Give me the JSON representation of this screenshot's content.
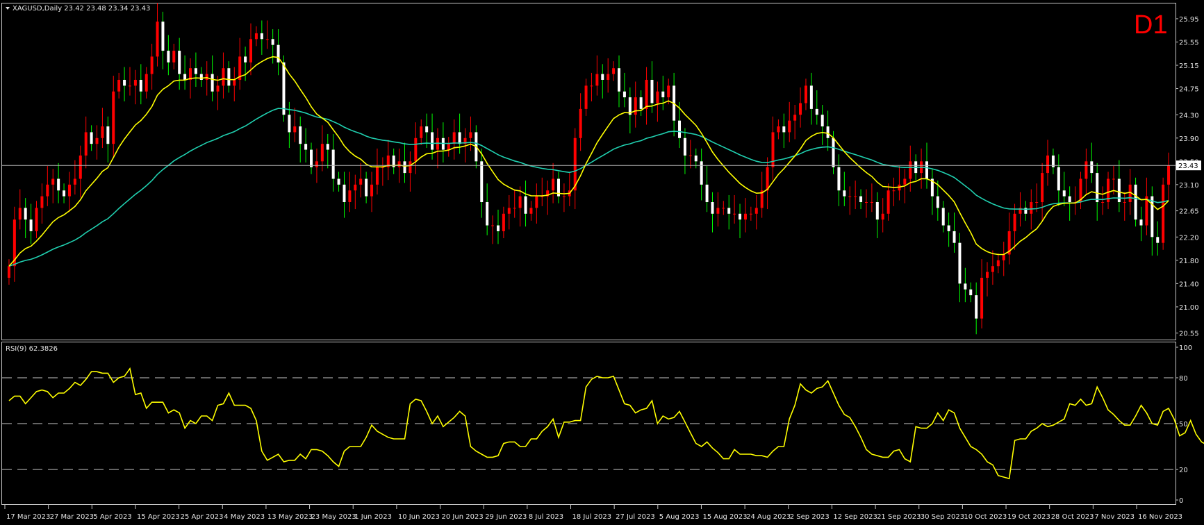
{
  "header": {
    "symbol_line": "XAGUSD,Daily  23.42 23.48 23.34 23.43",
    "timeframe_badge": "D1",
    "rsi_line": "RSI(9) 62.3826"
  },
  "colors": {
    "background": "#000000",
    "frame": "#c8c8c8",
    "up_candle": "#ff0000",
    "down_candle": "#ffffff",
    "wick_up": "#ff0000",
    "wick_down": "#00ff00",
    "ma_fast": "#ffff00",
    "ma_slow": "#20d0b0",
    "rsi_line": "#ffff00",
    "level_line": "#c8c8c8",
    "badge": "#ff0000"
  },
  "chart_data": [
    {
      "type": "candlestick",
      "title": "XAGUSD,Daily",
      "ylim": [
        20.45,
        26.2
      ],
      "y_ticks": [
        "25.95",
        "25.55",
        "25.15",
        "24.75",
        "24.30",
        "23.90",
        "23.50",
        "23.10",
        "22.65",
        "22.20",
        "21.80",
        "21.40",
        "21.00",
        "20.55"
      ],
      "last_price_label": "23.43",
      "last_price": 23.43,
      "x_tick_labels": [
        "17 Mar 2023",
        "27 Mar 2023",
        "5 Apr 2023",
        "15 Apr 2023",
        "25 Apr 2023",
        "4 May 2023",
        "13 May 2023",
        "23 May 2023",
        "1 Jun 2023",
        "10 Jun 2023",
        "20 Jun 2023",
        "29 Jun 2023",
        "8 Jul 2023",
        "18 Jul 2023",
        "27 Jul 2023",
        "5 Aug 2023",
        "15 Aug 2023",
        "24 Aug 2023",
        "2 Sep 2023",
        "12 Sep 2023",
        "21 Sep 2023",
        "30 Sep 2023",
        "10 Oct 2023",
        "19 Oct 2023",
        "28 Oct 2023",
        "7 Nov 2023",
        "16 Nov 2023"
      ],
      "close": [
        21.7,
        22.5,
        22.7,
        22.5,
        22.3,
        22.7,
        22.9,
        23.1,
        23.2,
        23.0,
        22.9,
        23.1,
        23.2,
        23.6,
        24.0,
        23.8,
        23.9,
        24.1,
        23.8,
        24.7,
        24.9,
        24.8,
        24.8,
        24.9,
        24.7,
        25.0,
        25.3,
        25.9,
        25.4,
        25.2,
        25.4,
        25.0,
        24.9,
        25.1,
        25.0,
        24.9,
        25.0,
        24.7,
        24.8,
        25.1,
        24.8,
        24.9,
        25.3,
        25.2,
        25.6,
        25.7,
        25.6,
        25.6,
        25.5,
        25.2,
        24.3,
        24.0,
        24.1,
        23.8,
        23.7,
        23.4,
        23.5,
        23.8,
        23.7,
        23.2,
        23.1,
        22.8,
        23.0,
        23.1,
        23.2,
        22.9,
        23.1,
        23.4,
        23.4,
        23.6,
        23.4,
        23.5,
        23.3,
        23.5,
        23.9,
        24.1,
        24.0,
        23.7,
        23.9,
        23.7,
        23.8,
        24.0,
        23.8,
        23.9,
        24.0,
        23.5,
        22.8,
        22.4,
        22.4,
        22.3,
        22.6,
        22.7,
        22.7,
        22.9,
        22.6,
        22.7,
        22.9,
        22.9,
        23.0,
        23.2,
        22.9,
        22.9,
        23.0,
        23.9,
        24.4,
        24.8,
        24.8,
        25.0,
        24.9,
        25.0,
        25.1,
        24.7,
        24.6,
        24.3,
        24.6,
        24.4,
        24.9,
        24.5,
        24.7,
        24.6,
        24.8,
        24.2,
        23.9,
        23.6,
        23.6,
        23.5,
        23.1,
        22.8,
        22.6,
        22.7,
        22.7,
        22.6,
        22.6,
        22.5,
        22.6,
        22.6,
        22.7,
        23.0,
        23.4,
        24.0,
        24.1,
        24.0,
        24.2,
        24.3,
        24.5,
        24.8,
        24.4,
        24.3,
        24.1,
        23.9,
        23.4,
        23.0,
        22.9,
        22.9,
        22.9,
        22.8,
        22.8,
        22.8,
        22.5,
        22.6,
        23.0,
        23.0,
        23.1,
        23.2,
        23.5,
        23.3,
        23.5,
        23.2,
        22.9,
        22.7,
        22.4,
        22.3,
        22.1,
        21.4,
        21.3,
        21.2,
        20.8,
        21.5,
        21.6,
        21.7,
        21.8,
        21.9,
        22.3,
        22.6,
        22.7,
        22.6,
        22.8,
        22.8,
        23.3,
        23.6,
        23.4,
        23.0,
        22.9,
        22.8,
        22.8,
        23.2,
        23.5,
        23.3,
        22.8,
        22.8,
        23.2,
        23.2,
        22.8,
        22.8,
        23.1,
        22.5,
        22.4,
        22.9,
        22.2,
        22.1,
        23.1,
        23.43
      ]
    },
    {
      "type": "line",
      "title": "RSI(9)",
      "value_label": "62.3826",
      "ylim": [
        0,
        100
      ],
      "y_ticks": [
        "100",
        "80",
        "50",
        "20",
        "0"
      ],
      "levels": [
        80,
        50,
        20
      ],
      "values": [
        65,
        68,
        68,
        63,
        67,
        71,
        72,
        71,
        67,
        70,
        70,
        73,
        77,
        75,
        79,
        84,
        84,
        83,
        83,
        77,
        80,
        81,
        86,
        69,
        70,
        60,
        64,
        64,
        64,
        57,
        59,
        57,
        47,
        52,
        50,
        55,
        55,
        52,
        62,
        63,
        70,
        62,
        62,
        62,
        60,
        52,
        32,
        26,
        28,
        30,
        25,
        26,
        26,
        30,
        27,
        33,
        33,
        32,
        29,
        25,
        22,
        32,
        35,
        35,
        35,
        41,
        49,
        45,
        43,
        41,
        40,
        40,
        40,
        63,
        66,
        65,
        58,
        50,
        55,
        48,
        51,
        54,
        58,
        55,
        35,
        32,
        30,
        28,
        28,
        29,
        37,
        38,
        38,
        35,
        35,
        40,
        40,
        45,
        48,
        53,
        41,
        51,
        51,
        52,
        52,
        74,
        79,
        81,
        80,
        80,
        81,
        72,
        63,
        62,
        57,
        59,
        60,
        65,
        50,
        55,
        53,
        54,
        58,
        51,
        44,
        37,
        35,
        38,
        34,
        31,
        27,
        27,
        33,
        30,
        30,
        30,
        29,
        29,
        28,
        32,
        35,
        35,
        53,
        62,
        76,
        72,
        70,
        73,
        74,
        78,
        70,
        62,
        56,
        54,
        48,
        41,
        33,
        30,
        29,
        28,
        28,
        32,
        33,
        27,
        25,
        48,
        47,
        47,
        50,
        57,
        52,
        59,
        57,
        47,
        41,
        35,
        33,
        30,
        25,
        23,
        16,
        15,
        14,
        39,
        40,
        40,
        45,
        47,
        50,
        48,
        49,
        51,
        53,
        63,
        62,
        66,
        62,
        63,
        74,
        67,
        59,
        56,
        52,
        49,
        49,
        55,
        62,
        57,
        50,
        49,
        58,
        60,
        53,
        42,
        44,
        52,
        43,
        38,
        36,
        60,
        63,
        63
      ]
    }
  ]
}
